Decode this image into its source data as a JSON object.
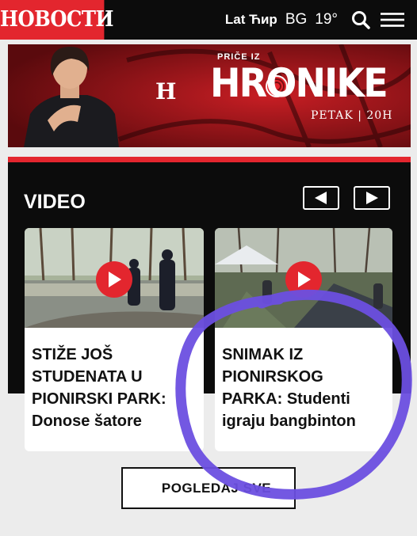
{
  "header": {
    "logo": "НОВОСТИ",
    "script_toggle": "Lat Ћир",
    "region": "BG",
    "temperature": "19°"
  },
  "banner": {
    "mark": "H",
    "show_pre": "PRIČE IZ",
    "show_title": "HRONIKE",
    "show_time": "PETAK | 20H"
  },
  "video": {
    "section_title": "VIDEO",
    "cards": [
      {
        "title": "STIŽE JOŠ STUDENATA U PIONIRSKI PARK: Donose šatore"
      },
      {
        "title": "SNIMAK IZ PIONIRSKOG PARKA: Studenti igraju bangbinton"
      }
    ]
  },
  "more_button": {
    "label": "POGLEDAJ SVE"
  },
  "colors": {
    "brand_red": "#e3262e",
    "header_bg": "#0c0c0c",
    "annotation_circle": "#6b4fe0"
  },
  "icons": [
    "search-icon",
    "hamburger-menu-icon",
    "arrow-left-icon",
    "arrow-right-icon",
    "play-icon"
  ]
}
